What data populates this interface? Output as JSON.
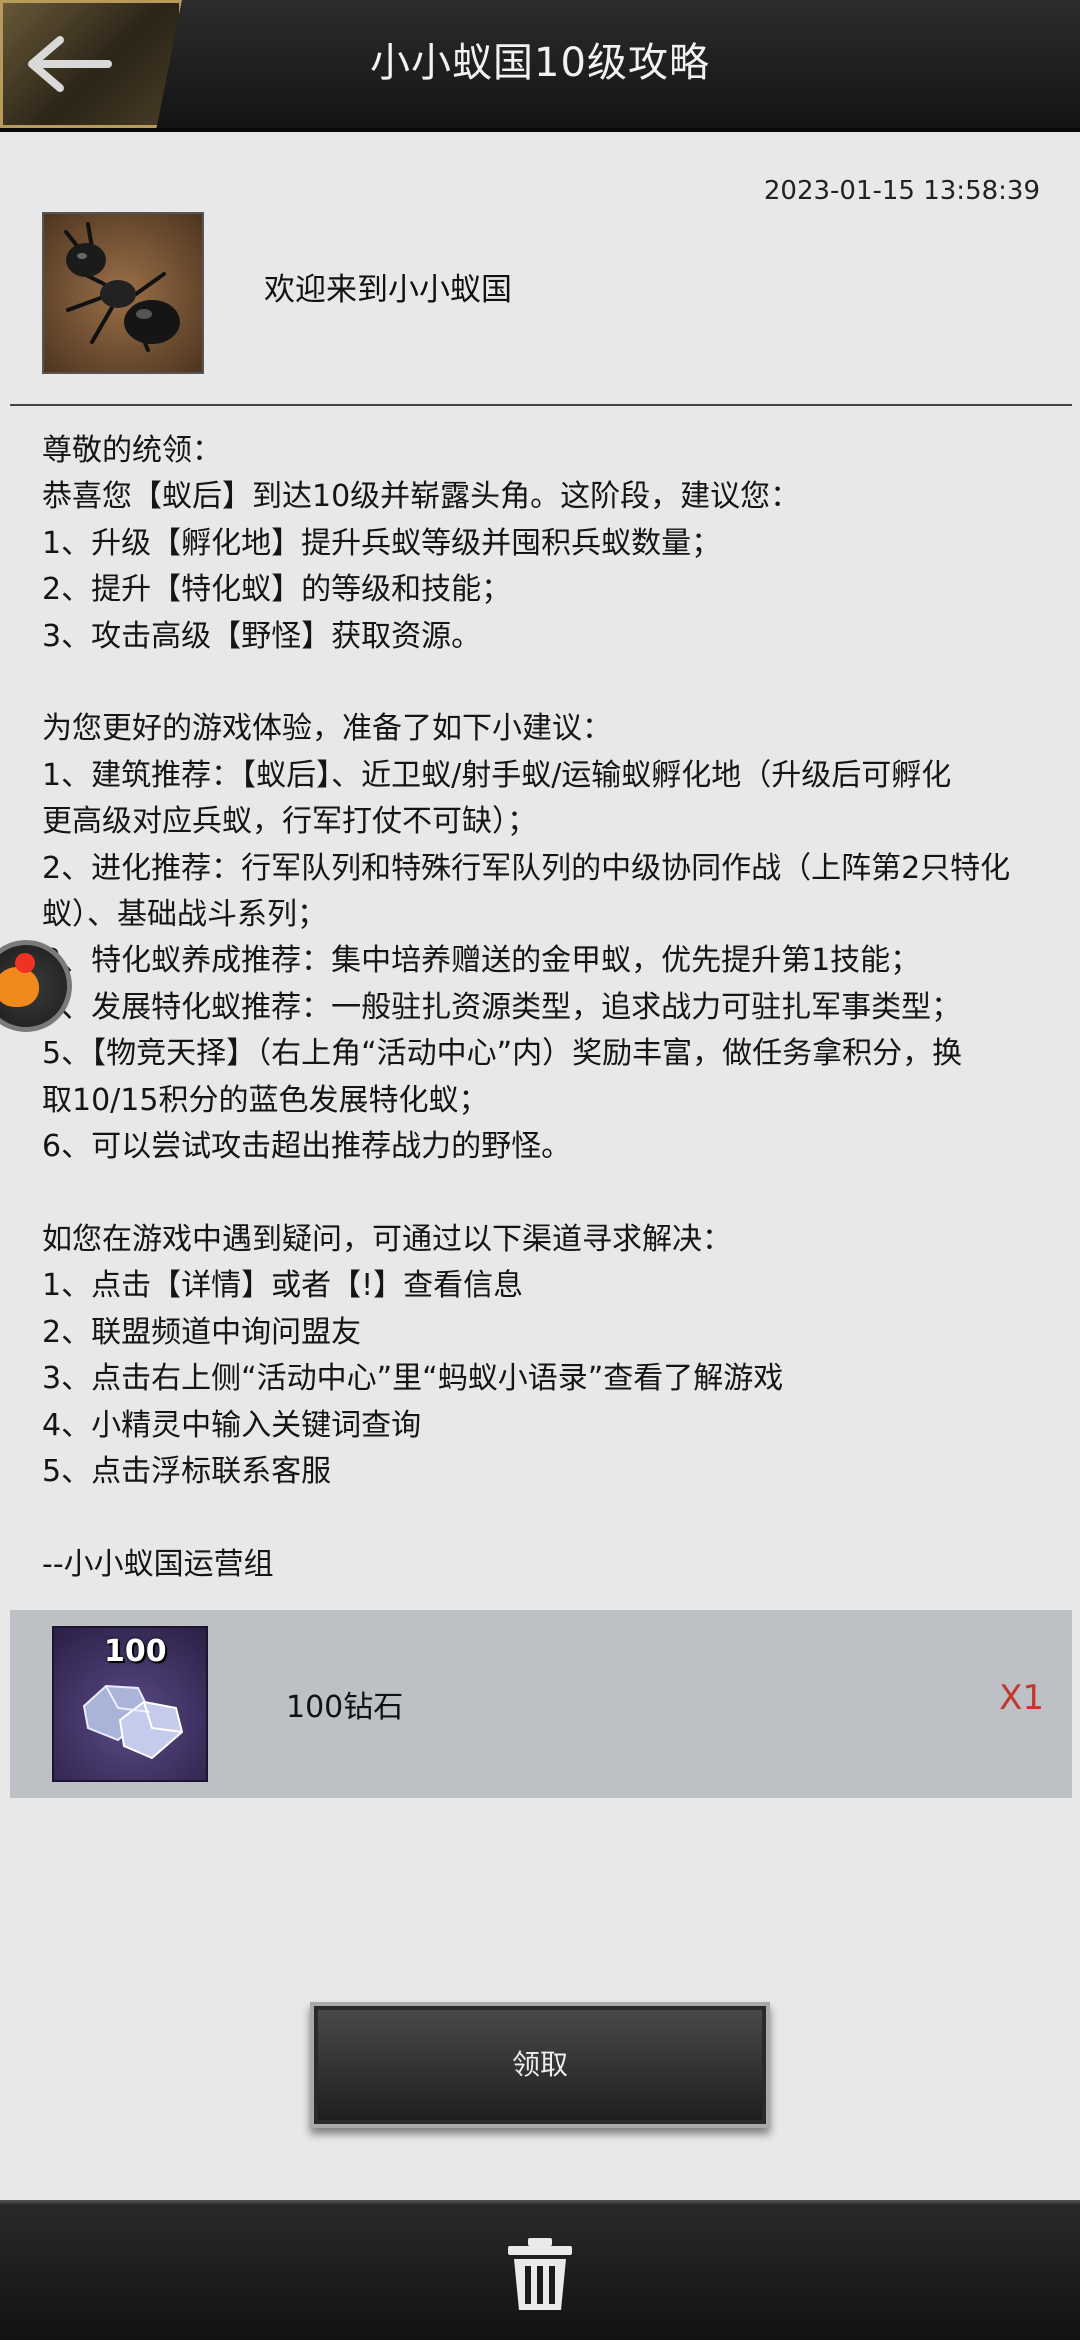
{
  "header": {
    "title": "小小蚁国10级攻略",
    "back_icon": "arrow-left-icon"
  },
  "mail": {
    "date": "2023-01-15 13:58:39",
    "sender_avatar_icon": "ant-avatar-icon",
    "sender": "欢迎来到小小蚁国",
    "body_lines": [
      "尊敬的统领：",
      "恭喜您【蚁后】到达10级并崭露头角。这阶段，建议您：",
      "1、升级【孵化地】提升兵蚁等级并囤积兵蚁数量；",
      "2、提升【特化蚁】的等级和技能；",
      "3、攻击高级【野怪】获取资源。",
      "",
      "为您更好的游戏体验，准备了如下小建议：",
      "1、建筑推荐：【蚁后】、近卫蚁/射手蚁/运输蚁孵化地（升级后可孵化",
      "更高级对应兵蚁，行军打仗不可缺）；",
      "2、进化推荐：行军队列和特殊行军队列的中级协同作战（上阵第2只特化",
      "蚁）、基础战斗系列；",
      "3、特化蚁养成推荐：集中培养赠送的金甲蚁，优先提升第1技能；",
      "4、发展特化蚁推荐：一般驻扎资源类型，追求战力可驻扎军事类型；",
      "5、【物竞天择】（右上角“活动中心”内）奖励丰富，做任务拿积分，换",
      "取10/15积分的蓝色发展特化蚁；",
      "6、可以尝试攻击超出推荐战力的野怪。",
      "",
      "如您在游戏中遇到疑问，可通过以下渠道寻求解决：",
      "1、点击【详情】或者【!】查看信息",
      "2、联盟频道中询问盟友",
      "3、点击右上侧“活动中心”里“蚂蚁小语录”查看了解游戏",
      "4、小精灵中输入关键词查询",
      "5、点击浮标联系客服",
      "",
      "--小小蚁国运营组"
    ]
  },
  "reward": {
    "icon": "diamond-icon",
    "icon_badge": "100",
    "name": "100钻石",
    "quantity": "X1"
  },
  "claim_button": {
    "label": "领取"
  },
  "floating_assistant": {
    "icon": "assistant-float-icon"
  },
  "bottom_bar": {
    "delete_icon": "trash-icon"
  },
  "colors": {
    "quantity": "#c0392b",
    "header_bg": "#1e1e1e",
    "page_bg": "#e8e8e8"
  }
}
